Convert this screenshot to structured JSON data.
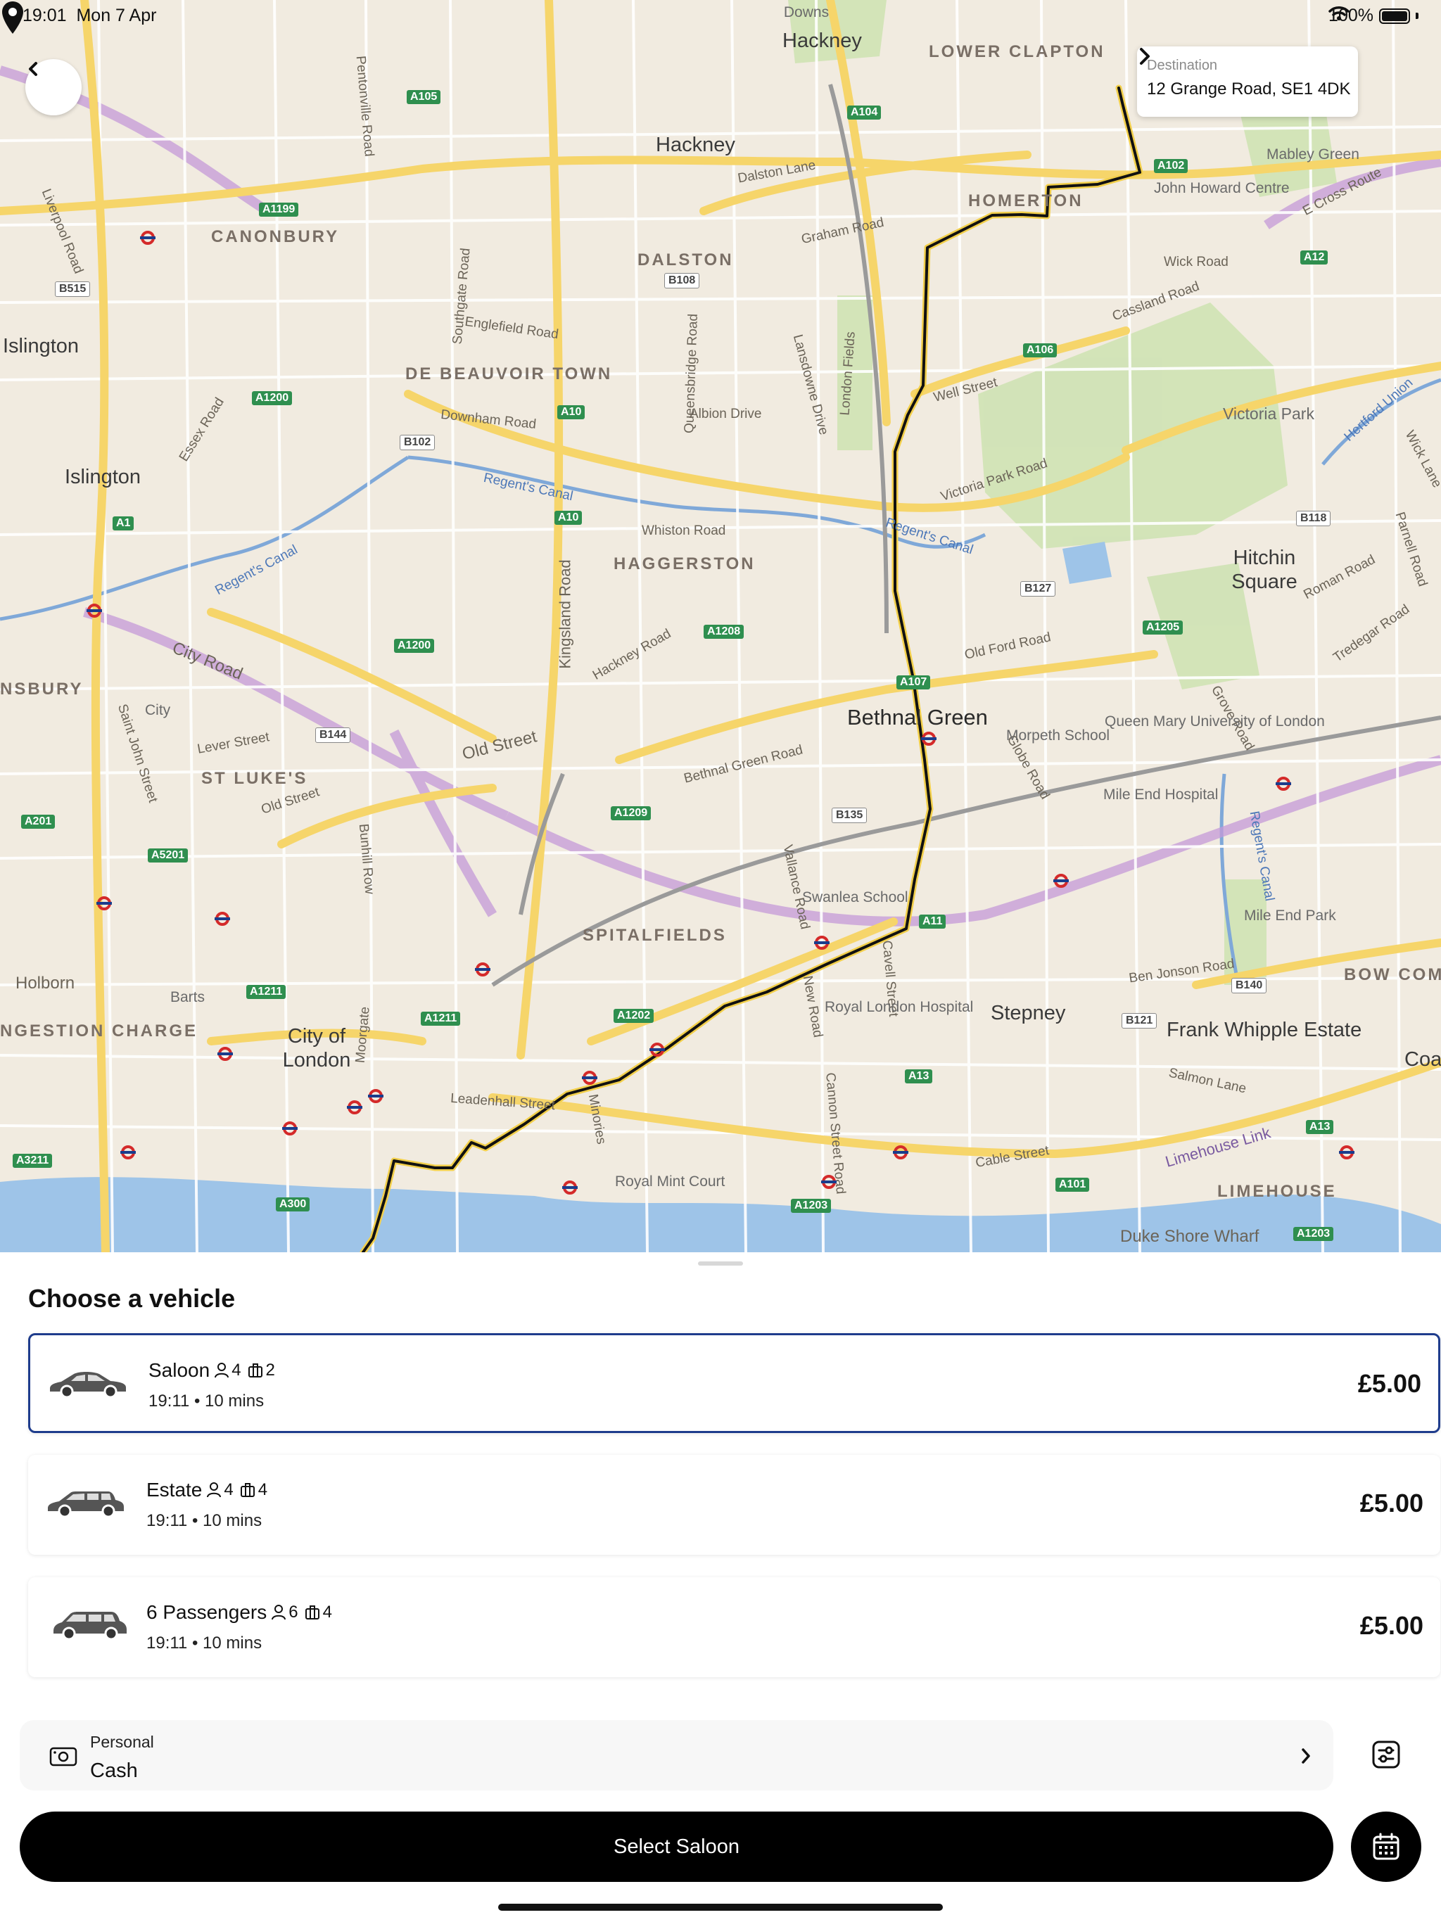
{
  "status_bar": {
    "time": "19:01",
    "date": "Mon 7 Apr",
    "battery": "100%"
  },
  "destination": {
    "label": "Destination",
    "address": "12 Grange Road, SE1 4DK"
  },
  "map": {
    "area_labels": [
      "LOWER CLAPTON",
      "CANONBURY",
      "DALSTON",
      "DE BEAUVOIR TOWN",
      "HAGGERSTON",
      "ST LUKE'S",
      "SPITALFIELDS",
      "HOMERTON",
      "LIMEHOUSE",
      "NGESTION CHARGE",
      "BOW COM",
      "NSBURY"
    ],
    "place_labels": [
      "Hackney",
      "Hackney",
      "Islington",
      "Islington",
      "Hitchin Square",
      "Bethnal Green",
      "Stepney",
      "City of London",
      "Frank Whipple Estate",
      "Victoria Park",
      "City",
      "Barts",
      "Coal"
    ],
    "road_labels": [
      "Dalston Lane",
      "Graham Road",
      "Wick Road",
      "Cassland Road",
      "E Cross Route",
      "Englefield Road",
      "Downham Road",
      "Albion Drive",
      "Well Street",
      "Victoria Park Road",
      "Regent's Canal",
      "Regent's Canal",
      "Regent's Canal",
      "Whiston Road",
      "Kingsland Road",
      "Hackney Road",
      "Old Ford Road",
      "City Road",
      "Old Street",
      "Old Street",
      "Lever Street",
      "Bethnal Green Road",
      "Roman Road",
      "Tredegar Road",
      "Grove Road",
      "Globe Road",
      "Ben Jonson Road",
      "Salmon Lane",
      "Cable Street",
      "Limehouse Link",
      "Leadenhall Street",
      "Minories",
      "New Road",
      "Cannon Street Road",
      "Cavell Street",
      "Vallance Road",
      "Holborn",
      "Moorgate",
      "Bunhill Row",
      "Southgate Road",
      "Queensbridge Road",
      "Lansdowne Drive",
      "London Fields",
      "Essex Road",
      "Liverpool Road",
      "Pentonville Road",
      "Saint John Street",
      "Regent's Canal",
      "Hertford Union",
      "Parnell Road",
      "Wick Lane",
      "Duke Shore Wharf"
    ],
    "poi_labels": [
      "John Howard Centre",
      "Mabley Green",
      "Queen Mary University of London",
      "Mile End Hospital",
      "Morpeth School",
      "Swanlea School",
      "Royal London Hospital",
      "Mile End Park",
      "Royal Mint Court",
      "Downs"
    ],
    "road_badges": [
      "A105",
      "A104",
      "A1199",
      "B108",
      "A102",
      "B515",
      "A1200",
      "A10",
      "A106",
      "A12",
      "B102",
      "A10",
      "B118",
      "A1",
      "B127",
      "A1205",
      "A1200",
      "A1208",
      "A107",
      "B144",
      "A1209",
      "B135",
      "A201",
      "A5201",
      "A11",
      "A1211",
      "A1211",
      "A1202",
      "B140",
      "B121",
      "A13",
      "A3211",
      "A300",
      "A1203",
      "A101",
      "A13",
      "A1203"
    ]
  },
  "sheet": {
    "title": "Choose a vehicle",
    "vehicles": [
      {
        "name": "Saloon",
        "passengers": "4",
        "luggage": "2",
        "time": "19:11",
        "duration": "10 mins",
        "price": "£5.00",
        "selected": true,
        "icon": "car-saloon-icon"
      },
      {
        "name": "Estate",
        "passengers": "4",
        "luggage": "4",
        "time": "19:11",
        "duration": "10 mins",
        "price": "£5.00",
        "selected": false,
        "icon": "car-estate-icon"
      },
      {
        "name": "6 Passengers",
        "passengers": "6",
        "luggage": "4",
        "time": "19:11",
        "duration": "10 mins",
        "price": "£5.00",
        "selected": false,
        "icon": "car-mpv-icon"
      }
    ],
    "payment": {
      "type": "Personal",
      "method": "Cash",
      "icon": "cash-icon"
    },
    "select_button": "Select Saloon",
    "icons": {
      "back": "chevron-left-icon",
      "filter": "filter-settings-icon",
      "schedule": "calendar-icon"
    }
  },
  "colors": {
    "accent": "#1e3c8c",
    "button": "#000000",
    "route": "#111111"
  }
}
